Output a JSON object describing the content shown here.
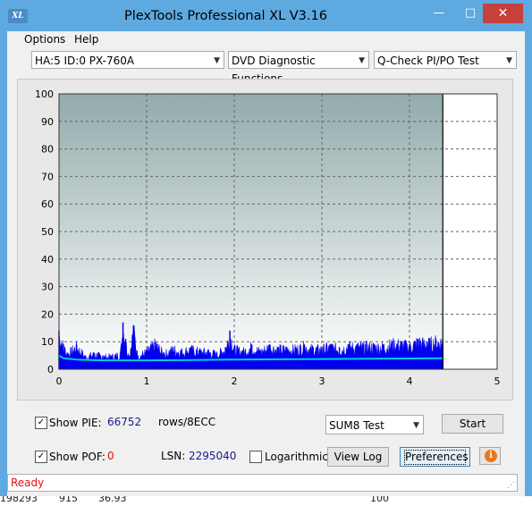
{
  "window": {
    "title": "PlexTools Professional XL V3.16",
    "icon_text": "XL"
  },
  "titlebar_buttons": {
    "minimize": "—",
    "maximize": "□",
    "close": "✕"
  },
  "menu": {
    "options_label": "Options",
    "help_label": "Help"
  },
  "dropdowns": {
    "drive": "HA:5 ID:0  PX-760A",
    "function": "DVD Diagnostic Functions",
    "test": "Q-Check PI/PO Test"
  },
  "chart_data": {
    "type": "area",
    "x_ticks": [
      "0",
      "1",
      "2",
      "3",
      "4",
      "5"
    ],
    "y_ticks": [
      "0",
      "10",
      "20",
      "30",
      "40",
      "50",
      "60",
      "70",
      "80",
      "90",
      "100"
    ],
    "xlim": [
      0,
      5
    ],
    "ylim": [
      0,
      100
    ],
    "grid": true,
    "end_marker_x": 4.38,
    "series": [
      {
        "color": "#0000ee",
        "points": [
          [
            0.0,
            14
          ],
          [
            0.05,
            9
          ],
          [
            0.1,
            6
          ],
          [
            0.2,
            9
          ],
          [
            0.3,
            5
          ],
          [
            0.4,
            6
          ],
          [
            0.5,
            5
          ],
          [
            0.6,
            5
          ],
          [
            0.7,
            6
          ],
          [
            0.73,
            17
          ],
          [
            0.76,
            11
          ],
          [
            0.8,
            5
          ],
          [
            0.85,
            16
          ],
          [
            0.9,
            5
          ],
          [
            1.0,
            7
          ],
          [
            1.1,
            10
          ],
          [
            1.2,
            6
          ],
          [
            1.3,
            8
          ],
          [
            1.4,
            7
          ],
          [
            1.5,
            8
          ],
          [
            1.6,
            7
          ],
          [
            1.7,
            7
          ],
          [
            1.8,
            6
          ],
          [
            1.9,
            8
          ],
          [
            1.95,
            14
          ],
          [
            2.0,
            8
          ],
          [
            2.1,
            7
          ],
          [
            2.2,
            9
          ],
          [
            2.3,
            7
          ],
          [
            2.4,
            9
          ],
          [
            2.5,
            8
          ],
          [
            2.6,
            8
          ],
          [
            2.7,
            8
          ],
          [
            2.8,
            9
          ],
          [
            2.9,
            8
          ],
          [
            3.0,
            8
          ],
          [
            3.1,
            9
          ],
          [
            3.2,
            8
          ],
          [
            3.3,
            9
          ],
          [
            3.4,
            9
          ],
          [
            3.5,
            9
          ],
          [
            3.6,
            9
          ],
          [
            3.7,
            9
          ],
          [
            3.8,
            10
          ],
          [
            3.9,
            10
          ],
          [
            4.0,
            9
          ],
          [
            4.1,
            11
          ],
          [
            4.2,
            10
          ],
          [
            4.3,
            11
          ],
          [
            4.38,
            11
          ]
        ]
      },
      {
        "color": "#00d0e0",
        "points": [
          [
            0.0,
            5
          ],
          [
            0.05,
            4
          ],
          [
            0.2,
            3.5
          ],
          [
            0.5,
            3.2
          ],
          [
            1.0,
            3.2
          ],
          [
            1.5,
            3.3
          ],
          [
            2.0,
            3.5
          ],
          [
            2.5,
            3.6
          ],
          [
            3.0,
            3.7
          ],
          [
            3.5,
            3.8
          ],
          [
            4.0,
            3.9
          ],
          [
            4.38,
            4
          ]
        ]
      }
    ]
  },
  "controls": {
    "show_pie_label": "Show PIE:",
    "pie_value": "66752",
    "pie_unit": "rows/8ECC",
    "show_pof_label": "Show POF:",
    "pof_value": "0",
    "lsn_label": "LSN:",
    "lsn_value": "2295040",
    "logarithmic_label": "Logarithmic",
    "sum_select": "SUM8 Test",
    "start_button": "Start",
    "view_log_button": "View Log",
    "preferences_button": "Preferences",
    "info_icon": "i",
    "show_pie_checked": true,
    "show_pof_checked": true,
    "logarithmic_checked": false,
    "check_mark": "✓"
  },
  "status": {
    "text": "Ready"
  },
  "underlay": {
    "col1": "198293",
    "col2": "915",
    "col3": "36.93",
    "col4": "100"
  }
}
